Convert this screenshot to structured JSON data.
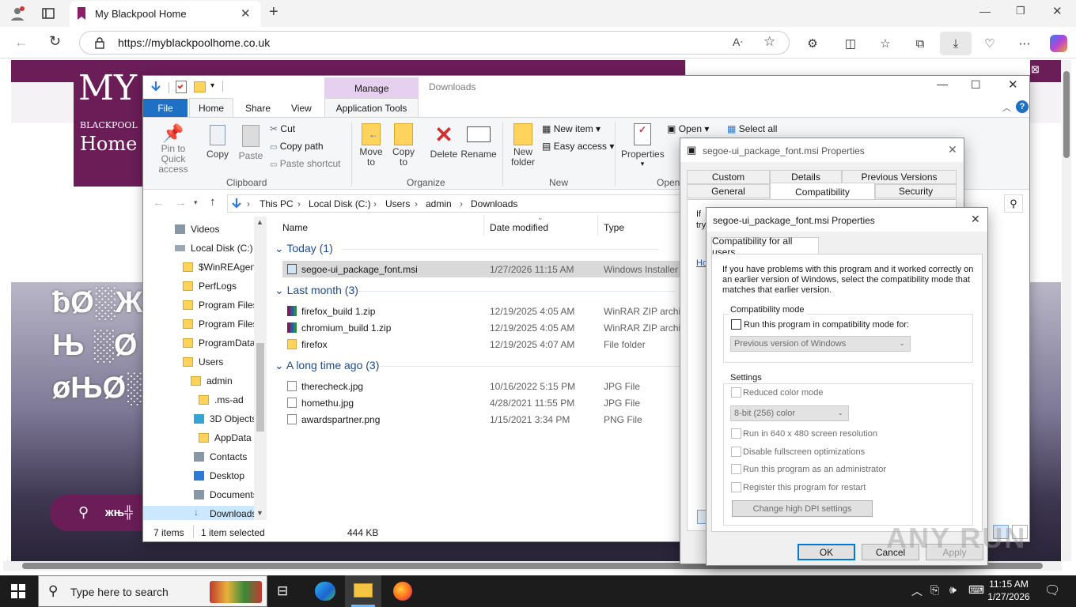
{
  "browser": {
    "tab_title": "My Blackpool Home",
    "url": "https://myblackpoolhome.co.uk",
    "new_tab": "+"
  },
  "website": {
    "logo_lines": [
      "MY",
      "BLACKPOOL",
      "Home"
    ],
    "hero_lines": [
      "ƀØ░Ж",
      "Њ ░Ø",
      "øЊØ░"
    ],
    "search_text": "жњ╬"
  },
  "explorer": {
    "title": "Downloads",
    "manage_tab": "Manage",
    "tabs": [
      "File",
      "Home",
      "Share",
      "View",
      "Application Tools"
    ],
    "clipboard": {
      "pin_label": "Pin to Quick access",
      "copy_label": "Copy",
      "paste_label": "Paste",
      "cut_label": "Cut",
      "copy_path_label": "Copy path",
      "paste_shortcut_label": "Paste shortcut",
      "group_label": "Clipboard"
    },
    "organize": {
      "move_to": "Move to",
      "copy_to": "Copy to",
      "delete": "Delete",
      "rename": "Rename",
      "group_label": "Organize"
    },
    "new": {
      "new_folder": "New folder",
      "new_item": "New item",
      "easy_access": "Easy access",
      "group_label": "New"
    },
    "open": {
      "properties": "Properties",
      "open": "Open",
      "select_all": "Select all",
      "group_label": "Open"
    },
    "breadcrumb": [
      "This PC",
      "Local Disk (C:)",
      "Users",
      "admin",
      "Downloads"
    ],
    "nav_items": [
      {
        "label": "Videos",
        "icon": "video-icon"
      },
      {
        "label": "Local Disk (C:)",
        "icon": "drive-icon"
      },
      {
        "label": "$WinREAgent",
        "icon": "folder-icon"
      },
      {
        "label": "PerfLogs",
        "icon": "folder-icon"
      },
      {
        "label": "Program Files",
        "icon": "folder-icon"
      },
      {
        "label": "Program Files",
        "icon": "folder-icon"
      },
      {
        "label": "ProgramData",
        "icon": "folder-icon"
      },
      {
        "label": "Users",
        "icon": "folder-icon"
      },
      {
        "label": "admin",
        "icon": "folder-icon"
      },
      {
        "label": ".ms-ad",
        "icon": "folder-icon"
      },
      {
        "label": "3D Objects",
        "icon": "3d-icon"
      },
      {
        "label": "AppData",
        "icon": "folder-icon"
      },
      {
        "label": "Contacts",
        "icon": "contacts-icon"
      },
      {
        "label": "Desktop",
        "icon": "desktop-icon"
      },
      {
        "label": "Documents",
        "icon": "documents-icon"
      },
      {
        "label": "Downloads",
        "icon": "downloads-icon"
      }
    ],
    "columns": {
      "name": "Name",
      "date": "Date modified",
      "type": "Type"
    },
    "groups": [
      {
        "header": "Today (1)",
        "files": [
          {
            "name": "segoe-ui_package_font.msi",
            "date": "1/27/2026 11:15 AM",
            "type": "Windows Installer",
            "icon": "msi-icon",
            "selected": true
          }
        ]
      },
      {
        "header": "Last month (3)",
        "files": [
          {
            "name": "firefox_build 1.zip",
            "date": "12/19/2025 4:05 AM",
            "type": "WinRAR ZIP archive",
            "icon": "zip-icon"
          },
          {
            "name": "chromium_build 1.zip",
            "date": "12/19/2025 4:05 AM",
            "type": "WinRAR ZIP archive",
            "icon": "zip-icon"
          },
          {
            "name": "firefox",
            "date": "12/19/2025 4:07 AM",
            "type": "File folder",
            "icon": "folder-icon"
          }
        ]
      },
      {
        "header": "A long time ago (3)",
        "files": [
          {
            "name": "therecheck.jpg",
            "date": "10/16/2022 5:15 PM",
            "type": "JPG File",
            "icon": "file-icon"
          },
          {
            "name": "homethu.jpg",
            "date": "4/28/2021 11:55 PM",
            "type": "JPG File",
            "icon": "file-icon"
          },
          {
            "name": "awardspartner.png",
            "date": "1/15/2021 3:34 PM",
            "type": "PNG File",
            "icon": "file-icon"
          }
        ]
      }
    ],
    "status": {
      "items": "7 items",
      "selected": "1 item selected",
      "size": "444 KB"
    }
  },
  "props_back": {
    "title": "segoe-ui_package_font.msi Properties",
    "tabs_row1": [
      "Custom",
      "Details",
      "Previous Versions"
    ],
    "tabs_row2": [
      "General",
      "Compatibility",
      "Security"
    ],
    "partial_lines": [
      "If",
      "try",
      "Ho"
    ]
  },
  "props_front": {
    "title": "segoe-ui_package_font.msi Properties",
    "tab": "Compatibility for all users",
    "intro": "If you have problems with this program and it worked correctly on an earlier version of Windows, select the compatibility mode that matches that earlier version.",
    "compat_group": "Compatibility mode",
    "compat_check": "Run this program in compatibility mode for:",
    "compat_combo": "Previous version of Windows",
    "settings_group": "Settings",
    "reduced_color": "Reduced color mode",
    "color_combo": "8-bit (256) color",
    "res_640": "Run in 640 x 480 screen resolution",
    "disable_fullscreen": "Disable fullscreen optimizations",
    "run_admin": "Run this program as an administrator",
    "register_restart": "Register this program for restart",
    "dpi_button": "Change high DPI settings",
    "ok": "OK",
    "cancel": "Cancel",
    "apply": "Apply"
  },
  "watermark": "ANY RUN",
  "taskbar": {
    "search_placeholder": "Type here to search",
    "time": "11:15 AM",
    "date": "1/27/2026"
  }
}
